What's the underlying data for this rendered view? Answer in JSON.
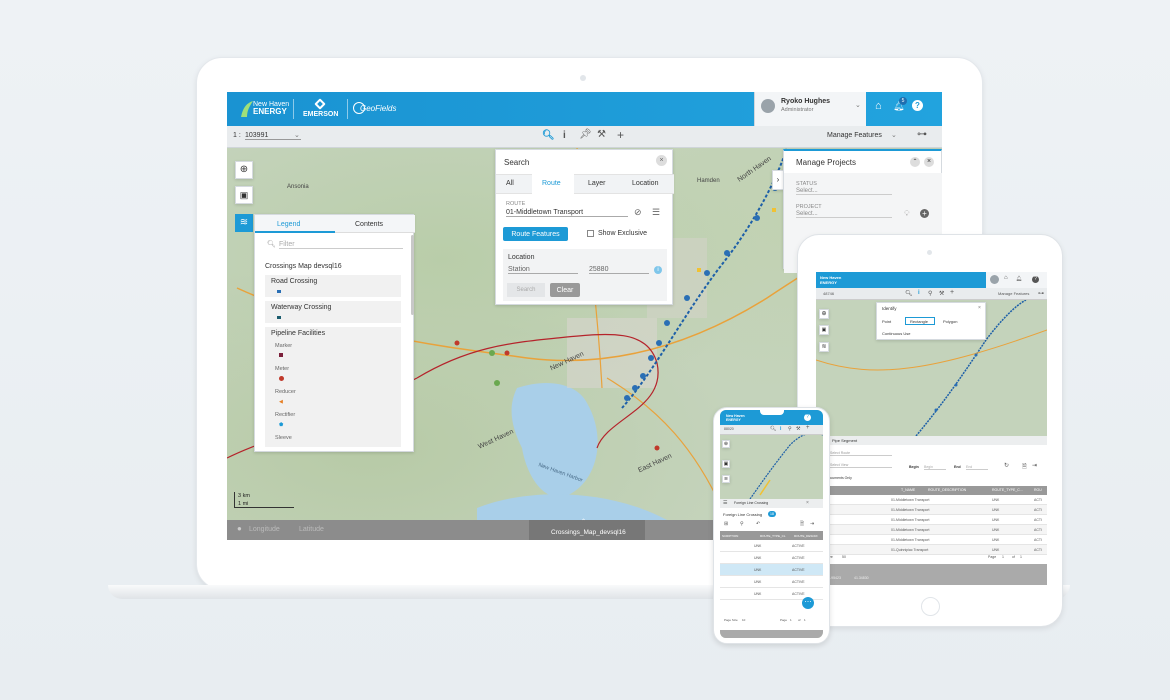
{
  "laptop": {
    "brand": {
      "new_haven_line1": "New Haven",
      "new_haven_line2": "ENERGY",
      "emerson": "EMERSON",
      "geofields": "GeoFields"
    },
    "user": {
      "name": "Ryoko Hughes",
      "role": "Administrator",
      "notification_count": "5"
    },
    "scale_prefix": "1 :",
    "scale_value": "103991",
    "manage_features_label": "Manage Features",
    "search_panel": {
      "title": "Search",
      "tabs": [
        "All",
        "Route",
        "Layer",
        "Location"
      ],
      "route_label": "ROUTE",
      "route_value": "01-Middletown Transport",
      "route_features_button": "Route Features",
      "show_exclusive_label": "Show Exclusive",
      "location_label": "Location",
      "location_type": "Station",
      "location_value": "25880",
      "search_button": "Search",
      "clear_button": "Clear"
    },
    "legend_panel": {
      "tab_legend": "Legend",
      "tab_contents": "Contents",
      "filter_placeholder": "Filter",
      "map_name": "Crossings Map devsql16",
      "groups": [
        {
          "name": "Road Crossing"
        },
        {
          "name": "Waterway Crossing"
        },
        {
          "name": "Pipeline Facilities",
          "items": [
            "Marker",
            "Meter",
            "Reducer",
            "Rectifier",
            "Sleeve"
          ]
        }
      ]
    },
    "projects_panel": {
      "title": "Manage Projects",
      "status_label": "STATUS",
      "status_placeholder": "Select...",
      "project_label": "PROJECT",
      "project_placeholder": "Select..."
    },
    "map_labels": [
      "North Haven",
      "New Haven",
      "West Haven",
      "East Haven",
      "New Haven Harbor",
      "Ansonia",
      "Hamden"
    ],
    "scalebar": {
      "km": "3 km",
      "mi": "1 mi"
    },
    "status": {
      "longitude": "Longitude",
      "latitude": "Latitude",
      "map_name": "Crossings_Map_devsql16"
    }
  },
  "tablet": {
    "scale": "48746",
    "manage_features": "Manage Features",
    "identify": {
      "title": "Identify",
      "point": "Point",
      "rectangle": "Rectangle",
      "polygon": "Polygon",
      "continuous": "Continuous Use"
    },
    "grid_panel": {
      "title": "Pipe Segment",
      "select_route": "Select Route",
      "select_view": "Select View",
      "begin": "Begin",
      "begin_placeholder": "Begin",
      "end": "End",
      "end_placeholder": "End",
      "documents_only": "Documents Only",
      "columns": [
        "T_NAME",
        "ROUTE_DESCRIPTION",
        "ROUTE_TYPE_C...",
        "ROU"
      ],
      "rows": [
        [
          "01-Middletown Transport",
          "UNK",
          "ACTI"
        ],
        [
          "01-Middletown Transport",
          "UNK",
          "ACTI"
        ],
        [
          "01-Middletown Transport",
          "UNK",
          "ACTI"
        ],
        [
          "01-Middletown Transport",
          "UNK",
          "ACTI"
        ],
        [
          "01-Middletown Transport",
          "UNK",
          "ACTI"
        ],
        [
          "01-Quinnipiac Transport",
          "UNK",
          "ACTI"
        ]
      ],
      "page_size_label": "Size",
      "page_size": "50",
      "page_label": "Page",
      "page_value": "1",
      "of_label": "of",
      "page_total": "1"
    },
    "status_left": "-95423",
    "status_right": "41.34830"
  },
  "phone": {
    "scale": "88020",
    "panel_title": "Foreign Line Crossing",
    "panel_badge": "18",
    "col1": "SCRIPTION",
    "col2": "ROUTE_TYPE_CL",
    "col3": "ROUTE_DESCRI",
    "rows": [
      [
        "UNK",
        "ACTIVE"
      ],
      [
        "UNK",
        "ACTIVE"
      ],
      [
        "UNK",
        "ACTIVE"
      ],
      [
        "UNK",
        "ACTIVE"
      ],
      [
        "UNK",
        "ACTIVE"
      ]
    ],
    "page_size_label": "Page Size",
    "page_size": "10",
    "page_label": "Page",
    "page_value": "1",
    "of_label": "of",
    "page_total": "1"
  }
}
